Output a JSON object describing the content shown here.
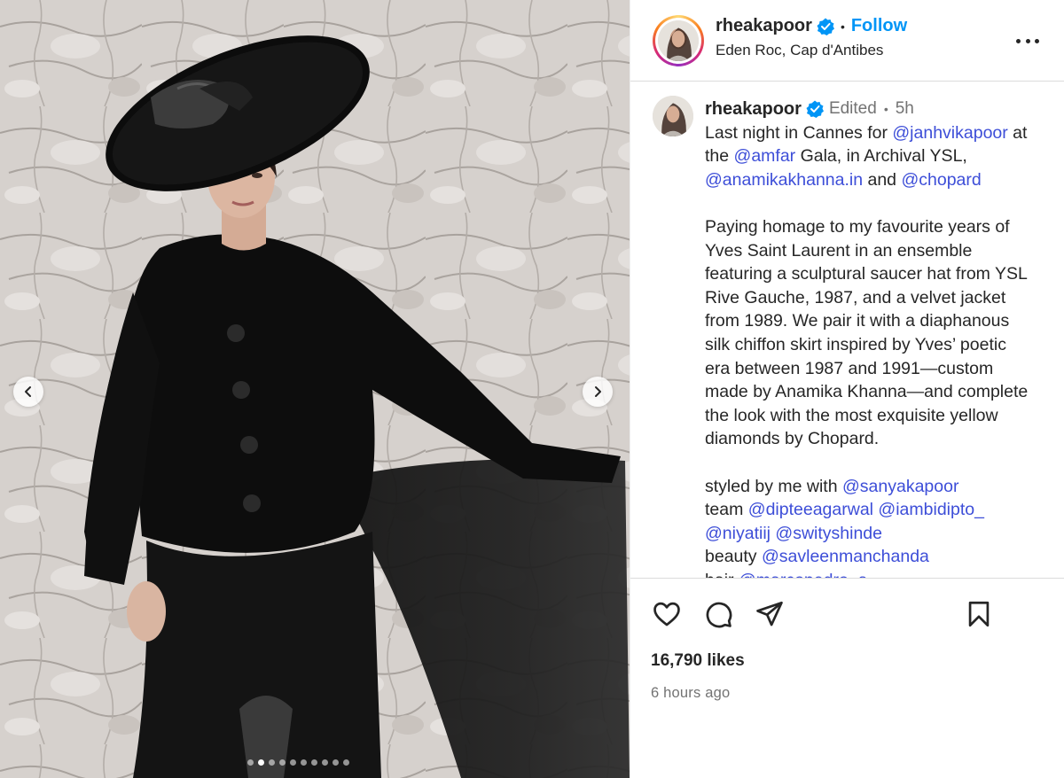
{
  "post": {
    "username": "rheakapoor",
    "follow_label": "Follow",
    "separator": "•",
    "location": "Eden Roc, Cap d'Antibes",
    "more_icon": "more-horizontal-icon"
  },
  "caption": {
    "username": "rheakapoor",
    "edited": "Edited",
    "separator": "•",
    "time": "5h",
    "l1_text": "Last night in Cannes for ",
    "l1_mention": "@janhvikapoor",
    "l1_end": " at",
    "l2_start": "the ",
    "l2_mention": "@amfar",
    "l2_end": " Gala, in Archival YSL,",
    "l3_mention1": "@anamikakhanna.in",
    "l3_mid": " and ",
    "l3_mention2": "@chopard",
    "p2_lines": [
      "Paying homage to my favourite years of",
      "Yves Saint Laurent in an ensemble",
      "featuring a sculptural saucer hat from YSL",
      "Rive Gauche, 1987, and a velvet jacket",
      "from 1989. We pair it with a diaphanous",
      "silk chiffon skirt inspired by Yves’ poetic",
      "era between 1987 and 1991—custom",
      "made by Anamika Khanna—and complete",
      "the look with the most exquisite yellow",
      "diamonds by Chopard."
    ],
    "styled_text": "styled by me with ",
    "styled_mention": "@sanyakapoor",
    "team_text": "team ",
    "team_mention1": "@dipteeagarwal",
    "team_mention2": "@iambidipto_",
    "team2_mention1": "@niyatiij",
    "team2_mention2": "@swityshinde",
    "beauty_text": "beauty ",
    "beauty_mention": "@savleenmanchanda",
    "hair_text": "hair ",
    "hair_mention": "@marcopedro_a"
  },
  "engagement": {
    "likes": "16,790 likes",
    "time_ago": "6 hours ago"
  },
  "carousel": {
    "total_slides": 10,
    "active_index": 1
  },
  "colors": {
    "link": "#3d4ed8",
    "follow": "#0095f6",
    "verified": "#0095f6",
    "muted": "#737373",
    "text": "#262626"
  }
}
